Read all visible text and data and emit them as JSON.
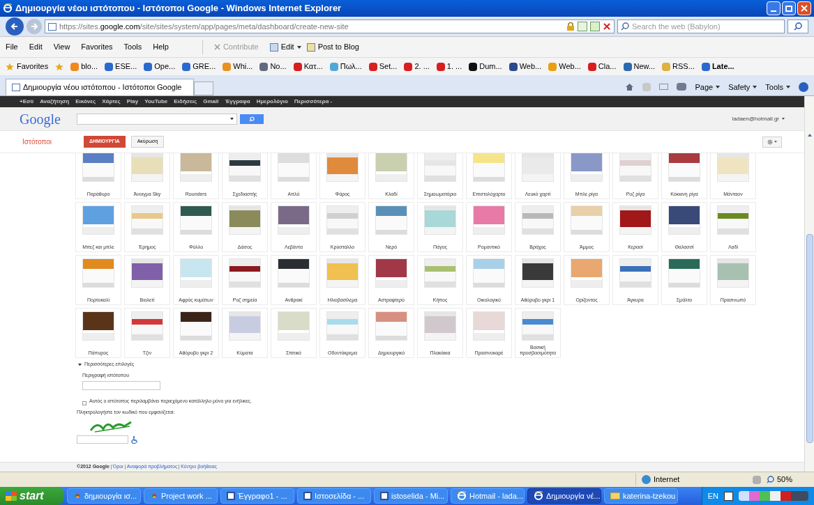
{
  "window": {
    "title": "Δημιουργία νέου ιστότοπου - Ιστότοποι Google - Windows Internet Explorer"
  },
  "address_bar": {
    "url_prefix": "https://sites.",
    "url_domain": "google.com",
    "url_rest": "/site/sites/system/app/pages/meta/dashboard/create-new-site",
    "search_placeholder": "Search the web (Babylon)"
  },
  "menu": [
    "File",
    "Edit",
    "View",
    "Favorites",
    "Tools",
    "Help"
  ],
  "blog_toolbar": {
    "contribute": "Contribute",
    "edit": "Edit",
    "post": "Post to Blog"
  },
  "favorites_bar": {
    "label": "Favorites",
    "items": [
      {
        "label": "blo...",
        "color": "#f08a1c"
      },
      {
        "label": "ESE...",
        "color": "#2a6ad0"
      },
      {
        "label": "Ope...",
        "color": "#2a6ad0"
      },
      {
        "label": "GRE...",
        "color": "#2a6ad0"
      },
      {
        "label": "Whi...",
        "color": "#e89020"
      },
      {
        "label": "No...",
        "color": "#606a80"
      },
      {
        "label": "Κατ...",
        "color": "#d81e1e"
      },
      {
        "label": "Πωλ...",
        "color": "#50a8d8"
      },
      {
        "label": "Set...",
        "color": "#d82020"
      },
      {
        "label": "2. ...",
        "color": "#d81e1e"
      },
      {
        "label": "1. ...",
        "color": "#d81e1e"
      },
      {
        "label": "Dum...",
        "color": "#101010"
      },
      {
        "label": "Web...",
        "color": "#2a4a90"
      },
      {
        "label": "Web...",
        "color": "#e8a010"
      },
      {
        "label": "Cla...",
        "color": "#d81e1e"
      },
      {
        "label": "New...",
        "color": "#2a6ab0"
      },
      {
        "label": "RSS...",
        "color": "#e0b040"
      },
      {
        "label": "Late...",
        "color": "#2a6ad0"
      }
    ]
  },
  "tab": {
    "title": "Δημιουργία νέου ιστότοπου - Ιστότοποι Google"
  },
  "command_bar": [
    "Page",
    "Safety",
    "Tools"
  ],
  "google_bar": {
    "links": [
      "+Εσύ",
      "Αναζήτηση",
      "Εικόνες",
      "Χάρτες",
      "Play",
      "YouTube",
      "Ειδήσεις",
      "Gmail",
      "Έγγραφα",
      "Ημερολόγιο",
      "Περισσότερα -"
    ],
    "logo": "Google",
    "account": "ladaen@hotmail.gr"
  },
  "sites_header": {
    "title": "Ιστότοποι",
    "create_button": "ΔΗΜΙΟΥΡΓΙΑ",
    "cancel_button": "Ακύρωση"
  },
  "themes": [
    {
      "name": "Παράθυρο",
      "color": "#5b7fc4"
    },
    {
      "name": "Άνοιγμα Sky",
      "color": "#e8dfb8"
    },
    {
      "name": "Rounders",
      "color": "#c9b89a"
    },
    {
      "name": "Σχεδιαστής",
      "color": "#2a3a40"
    },
    {
      "name": "Απλό",
      "color": "#dddddd"
    },
    {
      "name": "Φάρος",
      "color": "#e08a3c"
    },
    {
      "name": "Κλαδί",
      "color": "#c8d0b0"
    },
    {
      "name": "Σημειωματάριο",
      "color": "#e6e6e6"
    },
    {
      "name": "Επιστολόχαρτο",
      "color": "#f5e58a"
    },
    {
      "name": "Λευκό χαρτί",
      "color": "#eaeaea"
    },
    {
      "name": "Μπλε ρίγα",
      "color": "#8a98c8"
    },
    {
      "name": "Ροζ ρίγα",
      "color": "#e0d0d0"
    },
    {
      "name": "Κόκκινη ρίγα",
      "color": "#a83a40"
    },
    {
      "name": "Μάνταον",
      "color": "#f0e4c0"
    },
    {
      "name": "Μπεζ και μπλε",
      "color": "#5fa0e0"
    },
    {
      "name": "Έρημος",
      "color": "#e8c98a"
    },
    {
      "name": "Φύλλο",
      "color": "#2f5a50"
    },
    {
      "name": "Δάσος",
      "color": "#8a8a5a"
    },
    {
      "name": "Λεβάντα",
      "color": "#7a6a88"
    },
    {
      "name": "Κρύσταλλο",
      "color": "#d0d0d0"
    },
    {
      "name": "Νερό",
      "color": "#5a90b8"
    },
    {
      "name": "Πάγος",
      "color": "#a8d8d8"
    },
    {
      "name": "Ρομαντικό",
      "color": "#e87aa8"
    },
    {
      "name": "Βράχος",
      "color": "#b8b8b8"
    },
    {
      "name": "Άμμος",
      "color": "#e8d0a8"
    },
    {
      "name": "Κερασί",
      "color": "#a01818"
    },
    {
      "name": "Θαλασσί",
      "color": "#3a4a78"
    },
    {
      "name": "Λαδί",
      "color": "#6a8a20"
    },
    {
      "name": "Πορτοκαλί",
      "color": "#e08a20"
    },
    {
      "name": "Βιολετί",
      "color": "#8060a8"
    },
    {
      "name": "Αφρός κυμάτων",
      "color": "#c8e6f0"
    },
    {
      "name": "Ροζ σημεία",
      "color": "#8a1a20"
    },
    {
      "name": "Ανθρακί",
      "color": "#2a2e33"
    },
    {
      "name": "Ηλιοβασίλεμα",
      "color": "#f0c050"
    },
    {
      "name": "Αστραφτερό",
      "color": "#a03848"
    },
    {
      "name": "Κήπος",
      "color": "#a8c070"
    },
    {
      "name": "Οικολογικό",
      "color": "#a8d0e8"
    },
    {
      "name": "Αθόρυβο γκρι 1",
      "color": "#3a3a3a"
    },
    {
      "name": "Ορίζοντας",
      "color": "#e8a870"
    },
    {
      "name": "Άγκυρα",
      "color": "#3a70b8"
    },
    {
      "name": "Σμάλτο",
      "color": "#2a6a58"
    },
    {
      "name": "Πρασινωπό",
      "color": "#a8c0b0"
    },
    {
      "name": "Πάπυρος",
      "color": "#5a3418"
    },
    {
      "name": "Τζιν",
      "color": "#d03a3a"
    },
    {
      "name": "Αθόρυβο γκρι 2",
      "color": "#3a2418"
    },
    {
      "name": "Κύματα",
      "color": "#c8cce0"
    },
    {
      "name": "Σπιτικό",
      "color": "#d8dcc8"
    },
    {
      "name": "Οδοντόκρεμα",
      "color": "#a8dcec"
    },
    {
      "name": "Δημιουργικό",
      "color": "#d89080"
    },
    {
      "name": "Πλακάκια",
      "color": "#d0c8cc"
    },
    {
      "name": "Πρασινοκαρέ",
      "color": "#e8d8d8"
    },
    {
      "name": "Βασική προσβασιμότητα",
      "color": "#4a8ad0"
    }
  ],
  "more_options": {
    "toggle": "Περισσότερες επιλογές",
    "expanded": true,
    "description_label": "Περιγραφή ιστότοπου",
    "adult_checkbox": {
      "label": "Αυτός ο ιστότοπος περιλαμβάνει περιεχόμενο κατάλληλο μόνο για ενήλικες.",
      "checked": false
    },
    "captcha_prompt": "Πληκτρολογήστε τον κωδικό που εμφανίζεται:"
  },
  "footer": {
    "copyright": "©2012 Google",
    "links": [
      "Όροι",
      "Αναφορά προβλήματος",
      "Κέντρο βοήθειας"
    ]
  },
  "status_bar": {
    "zone": "Internet",
    "zoom": "50%"
  },
  "taskbar": {
    "start": "start",
    "items": [
      {
        "label": "δημιουργία ισ...",
        "kind": "chrome",
        "selected": false
      },
      {
        "label": "Project work ...",
        "kind": "chrome",
        "selected": false
      },
      {
        "label": "Έγγραφο1 - ...",
        "kind": "word",
        "selected": false
      },
      {
        "label": "Ιστοσελίδα - ...",
        "kind": "word",
        "selected": false
      },
      {
        "label": "istoselida - Mi...",
        "kind": "word",
        "selected": false
      },
      {
        "label": "Hotmail - lada...",
        "kind": "ie",
        "selected": false
      },
      {
        "label": "Δημιουργία νέ...",
        "kind": "ie",
        "selected": true
      },
      {
        "label": "katerina-tzekou",
        "kind": "folder",
        "selected": false
      }
    ],
    "language": "EN"
  }
}
